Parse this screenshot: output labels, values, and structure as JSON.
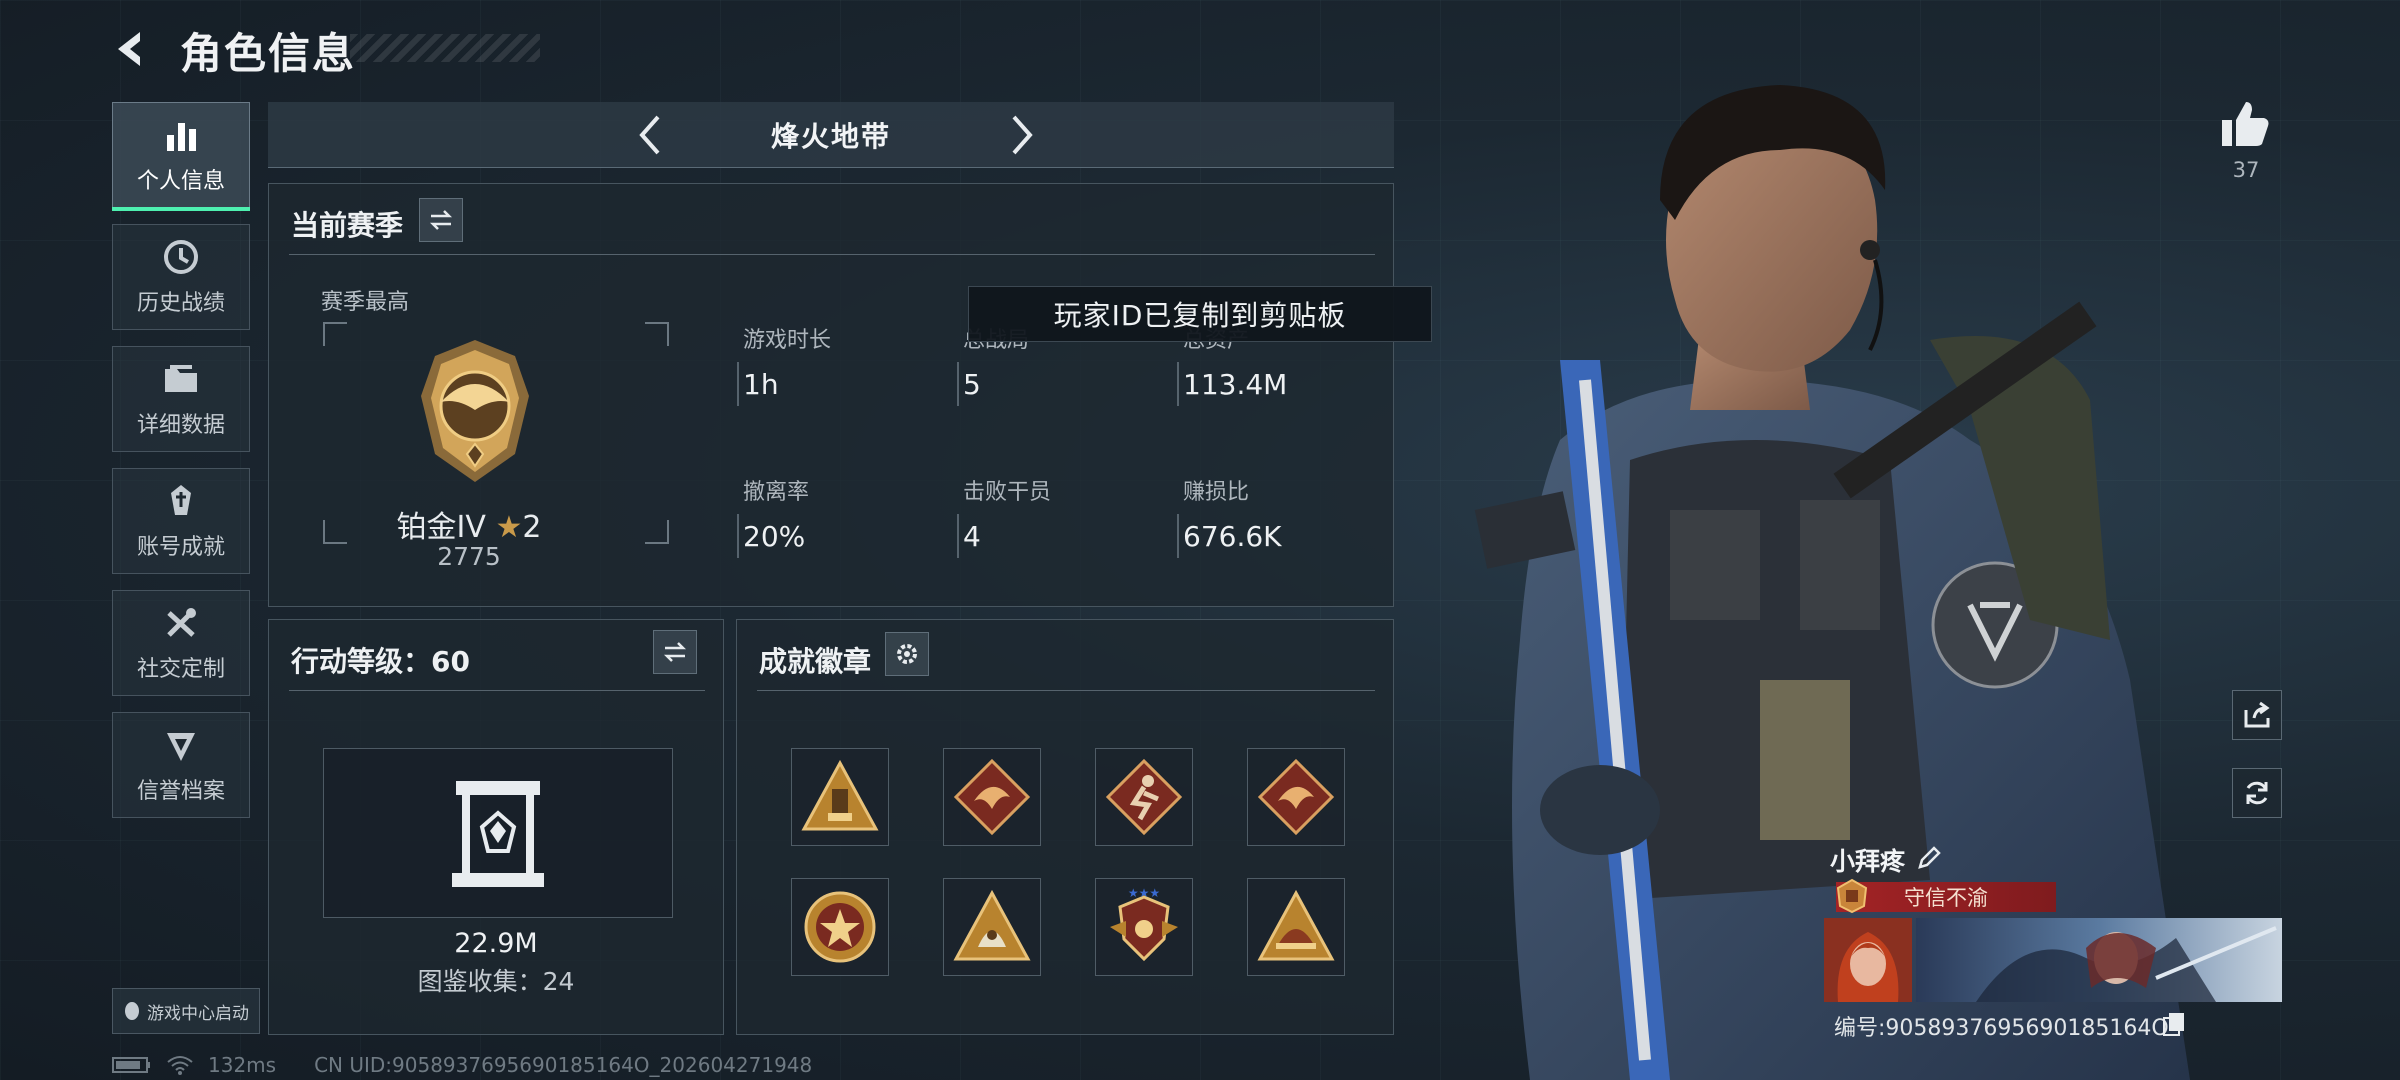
{
  "header": {
    "title": "角色信息"
  },
  "sidebar": {
    "items": [
      {
        "label": "个人信息",
        "icon": "bar-chart-icon",
        "active": true
      },
      {
        "label": "历史战绩",
        "icon": "clock-history-icon"
      },
      {
        "label": "详细数据",
        "icon": "folder-icon"
      },
      {
        "label": "账号成就",
        "icon": "achievement-icon"
      },
      {
        "label": "社交定制",
        "icon": "tools-icon"
      },
      {
        "label": "信誉档案",
        "icon": "reputation-icon"
      }
    ],
    "launch_label": "游戏中心启动"
  },
  "mode": {
    "title": "烽火地带"
  },
  "season": {
    "title": "当前赛季",
    "best_label": "赛季最高",
    "rank_name": "铂金IV",
    "rank_stars": "2",
    "rank_points": "2775",
    "stats": [
      {
        "label": "游戏时长",
        "value": "1h"
      },
      {
        "label": "总战局",
        "value": "5"
      },
      {
        "label": "总资产",
        "value": "113.4M"
      },
      {
        "label": "撤离率",
        "value": "20%"
      },
      {
        "label": "击败干员",
        "value": "4"
      },
      {
        "label": "赚损比",
        "value": "676.6K"
      }
    ]
  },
  "toast": {
    "text": "玩家ID已复制到剪贴板"
  },
  "action_level": {
    "title": "行动等级：60",
    "value": "22.9M",
    "collection": "图鉴收集：24"
  },
  "achievements": {
    "title": "成就徽章",
    "badges": [
      "triangle-tower-badge",
      "dragon-diamond-badge",
      "runner-diamond-badge",
      "dragon-diamond-badge-2",
      "star-circle-badge",
      "dome-triangle-badge",
      "shield-wings-badge",
      "helmet-triangle-badge"
    ]
  },
  "profile": {
    "likes": "37",
    "name": "小拜疼",
    "honor": "守信不渝",
    "player_id": "编号:9058937695690185164O"
  },
  "status": {
    "ping": "132ms",
    "uid": "CN UID:9058937695690185164O_202604271948"
  },
  "colors": {
    "accent": "#4ef0b0",
    "honor_red": "#a32325",
    "gold": "#c99a4a"
  }
}
